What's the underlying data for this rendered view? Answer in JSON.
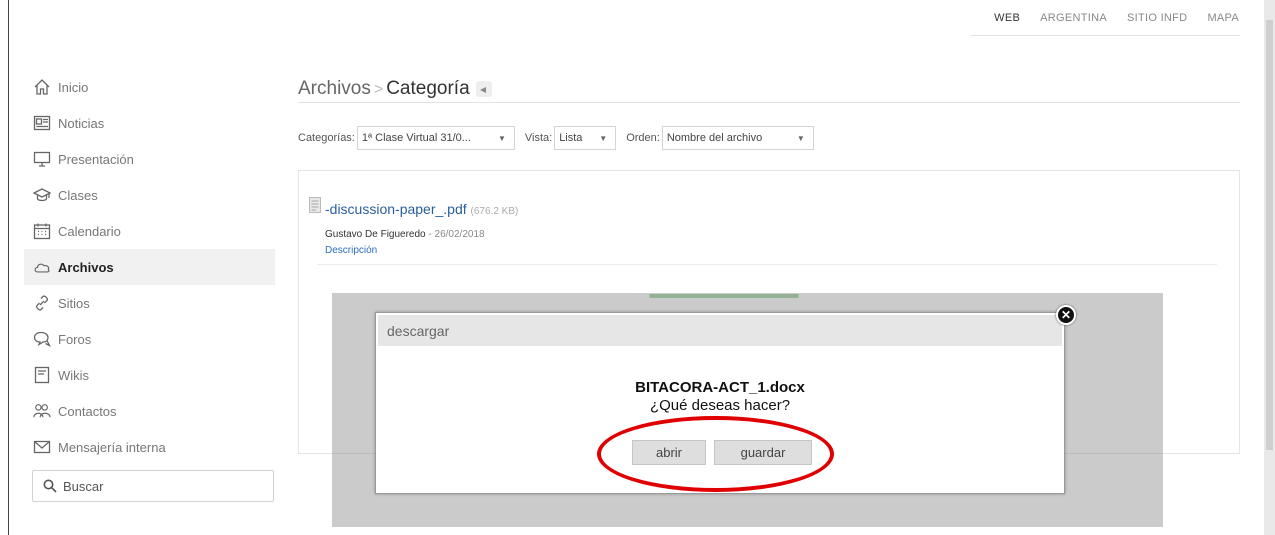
{
  "topnav": {
    "items": [
      "WEB",
      "ARGENTINA",
      "SITIO INFD",
      "MAPA"
    ]
  },
  "sidebar": {
    "items": [
      {
        "label": "Inicio",
        "icon": "home-icon"
      },
      {
        "label": "Noticias",
        "icon": "newspaper-icon"
      },
      {
        "label": "Presentación",
        "icon": "monitor-icon"
      },
      {
        "label": "Clases",
        "icon": "graduation-cap-icon"
      },
      {
        "label": "Calendario",
        "icon": "calendar-icon"
      },
      {
        "label": "Archivos",
        "icon": "cloud-icon",
        "active": true
      },
      {
        "label": "Sitios",
        "icon": "link-icon"
      },
      {
        "label": "Foros",
        "icon": "chat-bubbles-icon"
      },
      {
        "label": "Wikis",
        "icon": "wiki-page-icon"
      },
      {
        "label": "Contactos",
        "icon": "people-icon"
      },
      {
        "label": "Mensajería interna",
        "icon": "envelope-icon"
      }
    ],
    "search_label": "Buscar"
  },
  "breadcrumb": {
    "root": "Archivos",
    "separator": ">",
    "current": "Categoría"
  },
  "filters": {
    "categories_label": "Categorías:",
    "categories_value": "1ª Clase Virtual 31/0...",
    "view_label": "Vista:",
    "view_value": "Lista",
    "order_label": "Orden:",
    "order_value": "Nombre del archivo"
  },
  "file": {
    "name": "-discussion-paper_.pdf",
    "size": "(676.2 KB)",
    "author": "Gustavo De Figueredo",
    "date": "- 26/02/2018",
    "description_link": "Descripción"
  },
  "dialog": {
    "title": "descargar",
    "filename": "BITACORA-ACT_1.docx",
    "question": "¿Qué deseas hacer?",
    "open_label": "abrir",
    "save_label": "guardar",
    "close_glyph": "✕"
  },
  "colors": {
    "link": "#2a5d9e",
    "highlight_oval": "#e00000",
    "active_sidebar_bg": "#f1f1f1"
  }
}
